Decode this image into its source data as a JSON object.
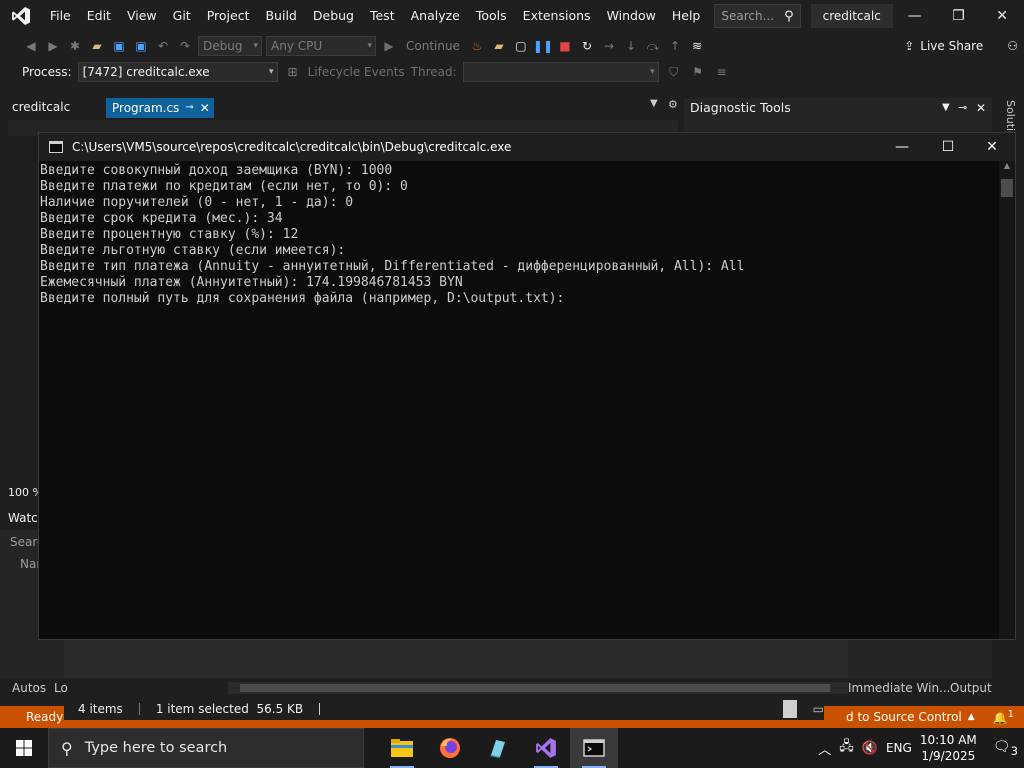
{
  "menubar": {
    "items": [
      "File",
      "Edit",
      "View",
      "Git",
      "Project",
      "Build",
      "Debug",
      "Test",
      "Analyze",
      "Tools",
      "Extensions",
      "Window",
      "Help"
    ],
    "search_placeholder": "Search...",
    "solution_name": "creditcalc",
    "minimize": "—",
    "maximize": "❐",
    "close": "✕"
  },
  "toolbar": {
    "config": "Debug",
    "platform": "Any CPU",
    "continue_label": "Continue",
    "live_share": "Live Share"
  },
  "procbar": {
    "label": "Process:",
    "process": "[7472] creditcalc.exe",
    "lifecycle": "Lifecycle Events",
    "thread": "Thread:"
  },
  "editor": {
    "project_tab": "creditcalc",
    "file_tab": "Program.cs",
    "zoom": "100 %",
    "watch": "Watc",
    "search": "Searc",
    "name_col": "Nar"
  },
  "diagnostics": {
    "title": "Diagnostic Tools",
    "solution_explorer": "Solutio"
  },
  "console": {
    "title": "C:\\Users\\VM5\\source\\repos\\creditcalc\\creditcalc\\bin\\Debug\\creditcalc.exe",
    "lines": [
      "Введите совокупный доход заемщика (BYN): 1000",
      "Введите платежи по кредитам (если нет, то 0): 0",
      "Наличие поручителей (0 - нет, 1 - да): 0",
      "Введите срок кредита (мес.): 34",
      "Введите процентную ставку (%): 12",
      "Введите льготную ставку (если имеется):",
      "Введите тип платежа (Annuity - аннуитетный, Differentiated - дифференцированный, All): All",
      "Ежемесячный платеж (Аннуитетный): 174.199846781453 BYN",
      "Введите полный путь для сохранения файла (например, D:\\output.txt):"
    ]
  },
  "bottom_tabs": {
    "autos": "Autos",
    "locals": "Lo",
    "immediate": "Immediate Win...",
    "output": "Output"
  },
  "explorer_status": {
    "items": "4 items",
    "selected": "1 item selected",
    "size": "56.5 KB"
  },
  "statusbar": {
    "ready": "Ready",
    "source_control": "d to Source Control",
    "notifications": "1"
  },
  "taskbar": {
    "search_placeholder": "Type here to search",
    "language": "ENG",
    "time": "10:10 AM",
    "date": "1/9/2025",
    "notification_count": "3"
  }
}
